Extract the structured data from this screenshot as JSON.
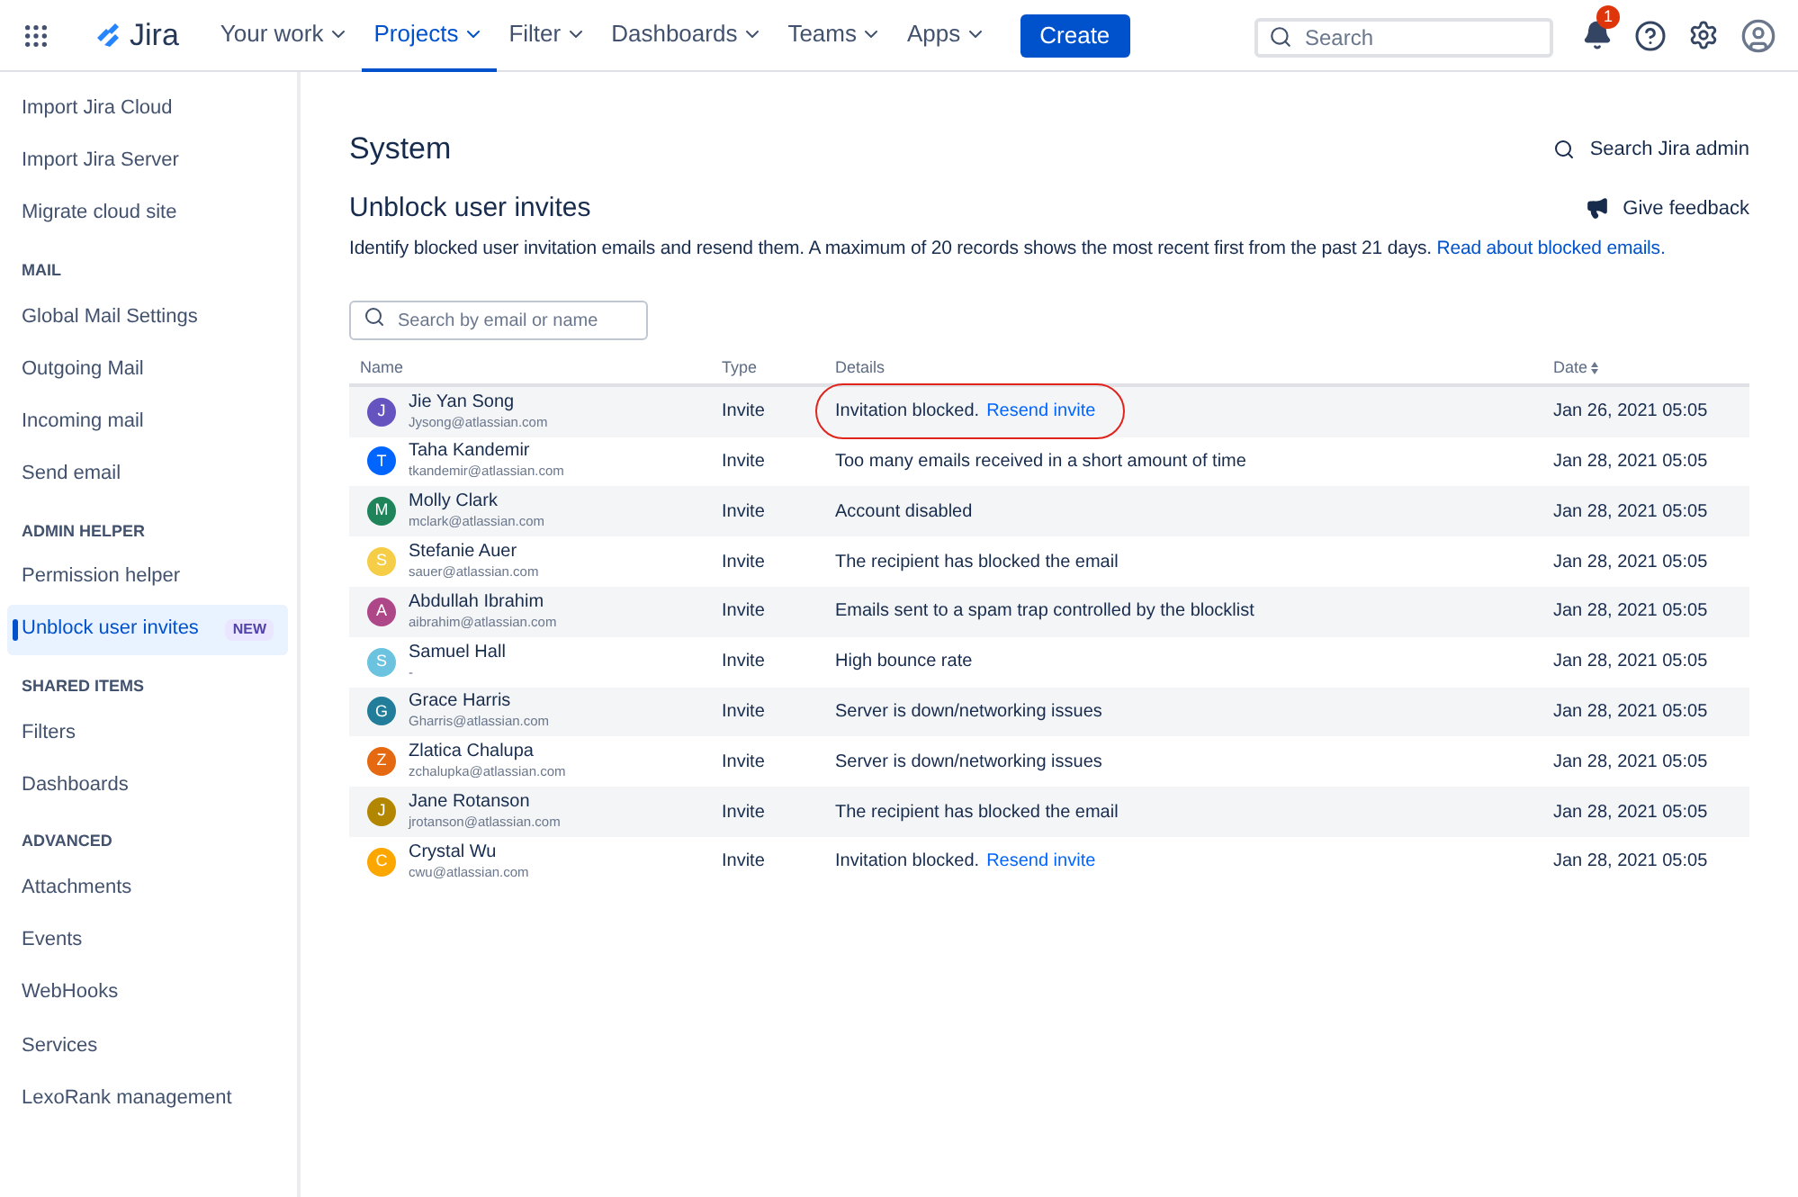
{
  "topbar": {
    "product": "Jira",
    "nav": [
      {
        "label": "Your work",
        "selected": false
      },
      {
        "label": "Projects",
        "selected": true
      },
      {
        "label": "Filter",
        "selected": false
      },
      {
        "label": "Dashboards",
        "selected": false
      },
      {
        "label": "Teams",
        "selected": false
      },
      {
        "label": "Apps",
        "selected": false
      }
    ],
    "create": "Create",
    "search": {
      "placeholder": "Search"
    },
    "notifications": "1"
  },
  "sidebar": [
    {
      "items": [
        {
          "label": "Import Jira Cloud",
          "selected": false
        },
        {
          "label": "Import Jira Server",
          "selected": false
        },
        {
          "label": "Migrate cloud site",
          "selected": false
        }
      ]
    },
    {
      "heading": "MAIL",
      "items": [
        {
          "label": "Global Mail Settings",
          "selected": false
        },
        {
          "label": "Outgoing Mail",
          "selected": false
        },
        {
          "label": "Incoming mail",
          "selected": false
        },
        {
          "label": "Send email",
          "selected": false
        }
      ]
    },
    {
      "heading": "ADMIN HELPER",
      "items": [
        {
          "label": "Permission helper",
          "selected": false
        },
        {
          "label": "Unblock user invites",
          "selected": true,
          "badge": "NEW"
        }
      ]
    },
    {
      "heading": "SHARED ITEMS",
      "items": [
        {
          "label": "Filters",
          "selected": false
        },
        {
          "label": "Dashboards",
          "selected": false
        }
      ]
    },
    {
      "heading": "ADVANCED",
      "items": [
        {
          "label": "Attachments",
          "selected": false
        },
        {
          "label": "Events",
          "selected": false
        },
        {
          "label": "WebHooks",
          "selected": false
        },
        {
          "label": "Services",
          "selected": false
        },
        {
          "label": "LexoRank management",
          "selected": false
        }
      ]
    }
  ],
  "page": {
    "title": "System",
    "admin_search": "Search Jira admin",
    "subtitle": "Unblock user invites",
    "feedback": "Give feedback",
    "description": "Identify blocked user invitation emails and resend them. A maximum of 20 records shows the most recent first from the past 21 days.",
    "description_link": "Read about blocked emails.",
    "filter": {
      "placeholder": "Search by email or name"
    }
  },
  "table": {
    "columns": [
      "Name",
      "Type",
      "Details",
      "Date"
    ],
    "rows": [
      {
        "initial": "J",
        "color": "#6554c0",
        "name": "Jie Yan Song",
        "email": "Jysong@atlassian.com",
        "type": "Invite",
        "details": "Invitation blocked.",
        "link": "Resend invite",
        "date": "Jan 26, 2021 05:05",
        "circled": true
      },
      {
        "initial": "T",
        "color": "#0065ff",
        "name": "Taha Kandemir",
        "email": "tkandemir@atlassian.com",
        "type": "Invite",
        "details": "Too many emails received in a short amount of time",
        "date": "Jan 28, 2021 05:05",
        "circled": false
      },
      {
        "initial": "M",
        "color": "#1f845a",
        "name": "Molly Clark",
        "email": "mclark@atlassian.com",
        "type": "Invite",
        "details": "Account disabled",
        "date": "Jan 28, 2021 05:05",
        "circled": false
      },
      {
        "initial": "S",
        "color": "#f5cd47",
        "name": "Stefanie Auer",
        "email": "sauer@atlassian.com",
        "type": "Invite",
        "details": "The recipient has blocked the email",
        "date": "Jan 28, 2021 05:05",
        "circled": false
      },
      {
        "initial": "A",
        "color": "#ae4787",
        "name": "Abdullah Ibrahim",
        "email": "aibrahim@atlassian.com",
        "type": "Invite",
        "details": "Emails sent to a spam trap controlled by the blocklist",
        "date": "Jan 28, 2021 05:05",
        "circled": false
      },
      {
        "initial": "S",
        "color": "#6cc3e0",
        "name": "Samuel Hall",
        "email": "-",
        "type": "Invite",
        "details": "High bounce rate",
        "date": "Jan 28, 2021 05:05",
        "circled": false
      },
      {
        "initial": "G",
        "color": "#227d9b",
        "name": "Grace Harris",
        "email": "Gharris@atlassian.com",
        "type": "Invite",
        "details": "Server is down/networking issues",
        "date": "Jan 28, 2021 05:05",
        "circled": false
      },
      {
        "initial": "Z",
        "color": "#e56910",
        "name": "Zlatica Chalupa",
        "email": "zchalupka@atlassian.com",
        "type": "Invite",
        "details": "Server is down/networking issues",
        "date": "Jan 28, 2021 05:05",
        "circled": false
      },
      {
        "initial": "J",
        "color": "#b38600",
        "name": "Jane Rotanson",
        "email": "jrotanson@atlassian.com",
        "type": "Invite",
        "details": "The recipient has blocked the email",
        "date": "Jan 28, 2021 05:05",
        "circled": false
      },
      {
        "initial": "C",
        "color": "#fca700",
        "name": "Crystal Wu",
        "email": "cwu@atlassian.com",
        "type": "Invite",
        "details": "Invitation blocked.",
        "link": "Resend invite",
        "date": "Jan 28, 2021 05:05",
        "circled": false
      }
    ]
  }
}
